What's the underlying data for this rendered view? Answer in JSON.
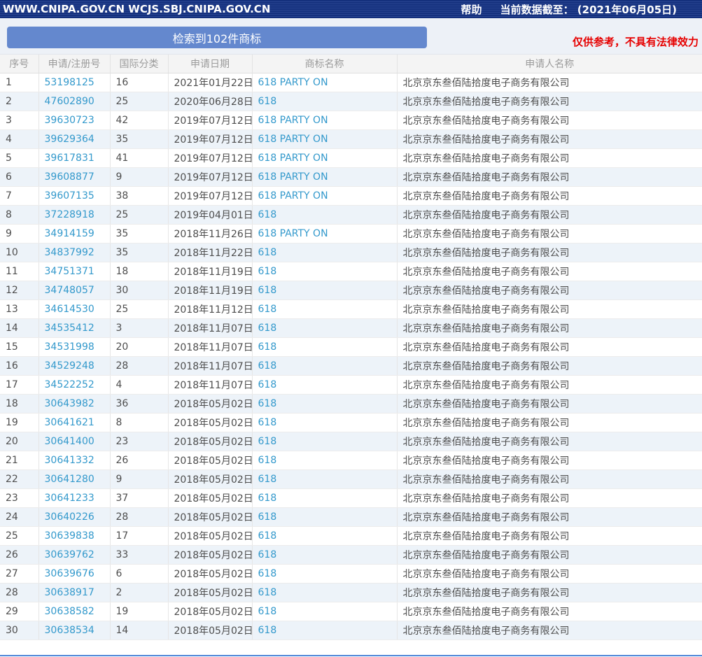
{
  "topbar": {
    "title": "WWW.CNIPA.GOV.CN WCJS.SBJ.CNIPA.GOV.CN",
    "help_label": "帮助",
    "data_cutoff_label": "当前数据截至： (2021年06月05日)"
  },
  "banner": {
    "result_count_label": "检索到102件商标",
    "disclaimer": "仅供参考，不具有法律效力"
  },
  "colors": {
    "topbar_bg": "#14307d",
    "result_button_bg": "#6488ce",
    "link_blue": "#3399cc",
    "disclaimer_red": "#e60000",
    "alt_row_bg": "#edf3f9",
    "bottom_line_blue": "#4f86d8"
  },
  "table": {
    "headers": [
      "序号",
      "申请/注册号",
      "国际分类",
      "申请日期",
      "商标名称",
      "申请人名称"
    ],
    "rows": [
      {
        "no": "1",
        "reg_no": "53198125",
        "intl_class": "16",
        "date": "2021年01月22日",
        "mark": "618 PARTY ON",
        "applicant": "北京京东叁佰陆拾度电子商务有限公司"
      },
      {
        "no": "2",
        "reg_no": "47602890",
        "intl_class": "25",
        "date": "2020年06月28日",
        "mark": "618",
        "applicant": "北京京东叁佰陆拾度电子商务有限公司"
      },
      {
        "no": "3",
        "reg_no": "39630723",
        "intl_class": "42",
        "date": "2019年07月12日",
        "mark": "618 PARTY ON",
        "applicant": "北京京东叁佰陆拾度电子商务有限公司"
      },
      {
        "no": "4",
        "reg_no": "39629364",
        "intl_class": "35",
        "date": "2019年07月12日",
        "mark": "618 PARTY ON",
        "applicant": "北京京东叁佰陆拾度电子商务有限公司"
      },
      {
        "no": "5",
        "reg_no": "39617831",
        "intl_class": "41",
        "date": "2019年07月12日",
        "mark": "618 PARTY ON",
        "applicant": "北京京东叁佰陆拾度电子商务有限公司"
      },
      {
        "no": "6",
        "reg_no": "39608877",
        "intl_class": "9",
        "date": "2019年07月12日",
        "mark": "618 PARTY ON",
        "applicant": "北京京东叁佰陆拾度电子商务有限公司"
      },
      {
        "no": "7",
        "reg_no": "39607135",
        "intl_class": "38",
        "date": "2019年07月12日",
        "mark": "618 PARTY ON",
        "applicant": "北京京东叁佰陆拾度电子商务有限公司"
      },
      {
        "no": "8",
        "reg_no": "37228918",
        "intl_class": "25",
        "date": "2019年04月01日",
        "mark": "618",
        "applicant": "北京京东叁佰陆拾度电子商务有限公司"
      },
      {
        "no": "9",
        "reg_no": "34914159",
        "intl_class": "35",
        "date": "2018年11月26日",
        "mark": "618 PARTY ON",
        "applicant": "北京京东叁佰陆拾度电子商务有限公司"
      },
      {
        "no": "10",
        "reg_no": "34837992",
        "intl_class": "35",
        "date": "2018年11月22日",
        "mark": "618",
        "applicant": "北京京东叁佰陆拾度电子商务有限公司"
      },
      {
        "no": "11",
        "reg_no": "34751371",
        "intl_class": "18",
        "date": "2018年11月19日",
        "mark": "618",
        "applicant": "北京京东叁佰陆拾度电子商务有限公司"
      },
      {
        "no": "12",
        "reg_no": "34748057",
        "intl_class": "30",
        "date": "2018年11月19日",
        "mark": "618",
        "applicant": "北京京东叁佰陆拾度电子商务有限公司"
      },
      {
        "no": "13",
        "reg_no": "34614530",
        "intl_class": "25",
        "date": "2018年11月12日",
        "mark": "618",
        "applicant": "北京京东叁佰陆拾度电子商务有限公司"
      },
      {
        "no": "14",
        "reg_no": "34535412",
        "intl_class": "3",
        "date": "2018年11月07日",
        "mark": "618",
        "applicant": "北京京东叁佰陆拾度电子商务有限公司"
      },
      {
        "no": "15",
        "reg_no": "34531998",
        "intl_class": "20",
        "date": "2018年11月07日",
        "mark": "618",
        "applicant": "北京京东叁佰陆拾度电子商务有限公司"
      },
      {
        "no": "16",
        "reg_no": "34529248",
        "intl_class": "28",
        "date": "2018年11月07日",
        "mark": "618",
        "applicant": "北京京东叁佰陆拾度电子商务有限公司"
      },
      {
        "no": "17",
        "reg_no": "34522252",
        "intl_class": "4",
        "date": "2018年11月07日",
        "mark": "618",
        "applicant": "北京京东叁佰陆拾度电子商务有限公司"
      },
      {
        "no": "18",
        "reg_no": "30643982",
        "intl_class": "36",
        "date": "2018年05月02日",
        "mark": "618",
        "applicant": "北京京东叁佰陆拾度电子商务有限公司"
      },
      {
        "no": "19",
        "reg_no": "30641621",
        "intl_class": "8",
        "date": "2018年05月02日",
        "mark": "618",
        "applicant": "北京京东叁佰陆拾度电子商务有限公司"
      },
      {
        "no": "20",
        "reg_no": "30641400",
        "intl_class": "23",
        "date": "2018年05月02日",
        "mark": "618",
        "applicant": "北京京东叁佰陆拾度电子商务有限公司"
      },
      {
        "no": "21",
        "reg_no": "30641332",
        "intl_class": "26",
        "date": "2018年05月02日",
        "mark": "618",
        "applicant": "北京京东叁佰陆拾度电子商务有限公司"
      },
      {
        "no": "22",
        "reg_no": "30641280",
        "intl_class": "9",
        "date": "2018年05月02日",
        "mark": "618",
        "applicant": "北京京东叁佰陆拾度电子商务有限公司"
      },
      {
        "no": "23",
        "reg_no": "30641233",
        "intl_class": "37",
        "date": "2018年05月02日",
        "mark": "618",
        "applicant": "北京京东叁佰陆拾度电子商务有限公司"
      },
      {
        "no": "24",
        "reg_no": "30640226",
        "intl_class": "28",
        "date": "2018年05月02日",
        "mark": "618",
        "applicant": "北京京东叁佰陆拾度电子商务有限公司"
      },
      {
        "no": "25",
        "reg_no": "30639838",
        "intl_class": "17",
        "date": "2018年05月02日",
        "mark": "618",
        "applicant": "北京京东叁佰陆拾度电子商务有限公司"
      },
      {
        "no": "26",
        "reg_no": "30639762",
        "intl_class": "33",
        "date": "2018年05月02日",
        "mark": "618",
        "applicant": "北京京东叁佰陆拾度电子商务有限公司"
      },
      {
        "no": "27",
        "reg_no": "30639676",
        "intl_class": "6",
        "date": "2018年05月02日",
        "mark": "618",
        "applicant": "北京京东叁佰陆拾度电子商务有限公司"
      },
      {
        "no": "28",
        "reg_no": "30638917",
        "intl_class": "2",
        "date": "2018年05月02日",
        "mark": "618",
        "applicant": "北京京东叁佰陆拾度电子商务有限公司"
      },
      {
        "no": "29",
        "reg_no": "30638582",
        "intl_class": "19",
        "date": "2018年05月02日",
        "mark": "618",
        "applicant": "北京京东叁佰陆拾度电子商务有限公司"
      },
      {
        "no": "30",
        "reg_no": "30638534",
        "intl_class": "14",
        "date": "2018年05月02日",
        "mark": "618",
        "applicant": "北京京东叁佰陆拾度电子商务有限公司"
      }
    ]
  }
}
